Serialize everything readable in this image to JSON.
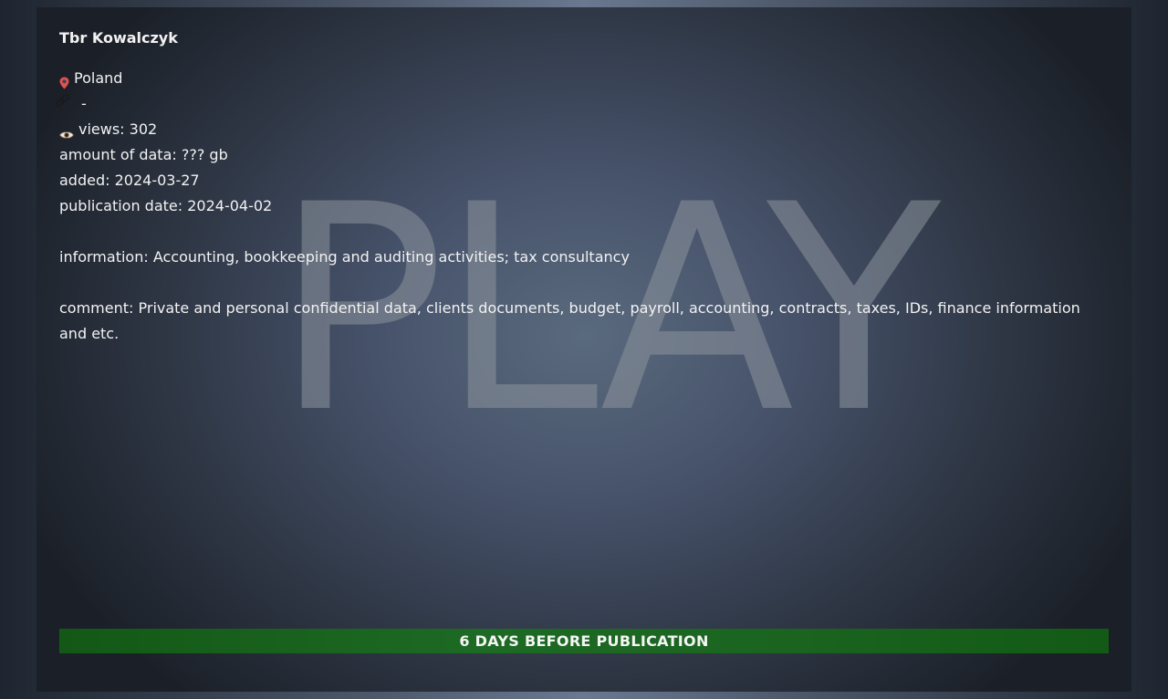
{
  "post": {
    "title": "Tbr Kowalczyk",
    "country": "Poland",
    "link": "-",
    "views": "views: 302",
    "amount": "amount of data: ??? gb",
    "added": "added: 2024-03-27",
    "publication": "publication date: 2024-04-02",
    "information": "information: Accounting, bookkeeping and auditing activities; tax consultancy",
    "comment": "comment: Private and personal confidential data, clients documents, budget, payroll, accounting, contracts, taxes, IDs, finance information and etc."
  },
  "watermark": "PLAY",
  "countdown": "6 DAYS BEFORE PUBLICATION",
  "icons": {
    "location": "location-pin-icon",
    "link": "link-icon",
    "views": "eye-icon"
  },
  "colors": {
    "countdown_bar": "#1b6622",
    "pin": "#e05252",
    "text": "#f2f2f2"
  }
}
